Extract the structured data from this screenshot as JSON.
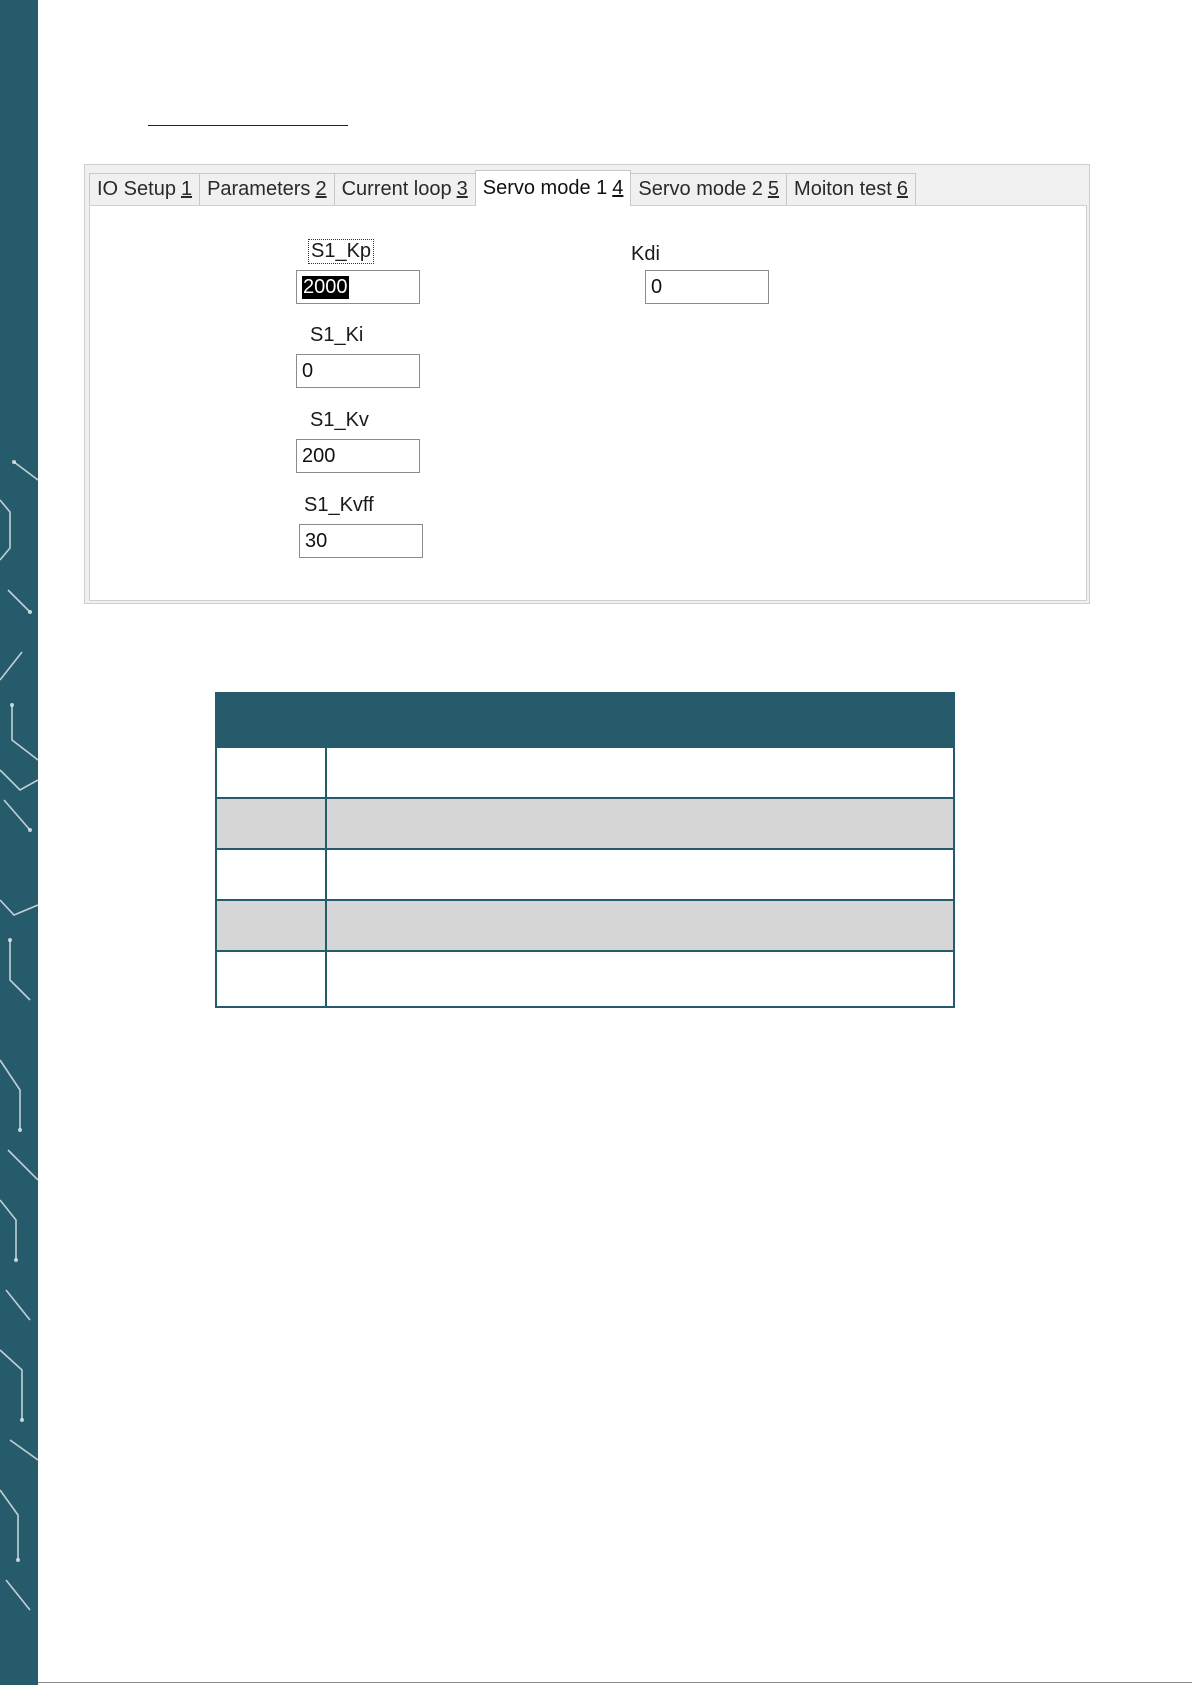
{
  "colors": {
    "accent": "#265b6b",
    "row_alt": "#d6d6d6"
  },
  "tabs": [
    {
      "label": "IO Setup",
      "key": "1"
    },
    {
      "label": "Parameters",
      "key": "2"
    },
    {
      "label": "Current loop",
      "key": "3"
    },
    {
      "label": "Servo mode 1",
      "key": "4"
    },
    {
      "label": "Servo mode 2",
      "key": "5"
    },
    {
      "label": "Moiton test",
      "key": "6"
    }
  ],
  "active_tab": "Servo mode 1",
  "fields": {
    "s1_kp": {
      "label": "S1_Kp",
      "value": "2000"
    },
    "s1_ki": {
      "label": "S1_Ki",
      "value": "0"
    },
    "s1_kv": {
      "label": "S1_Kv",
      "value": "200"
    },
    "s1_kvff": {
      "label": "S1_Kvff",
      "value": "30"
    },
    "kdi": {
      "label": "Kdi",
      "value": "0"
    }
  },
  "table": {
    "rows": 5
  }
}
